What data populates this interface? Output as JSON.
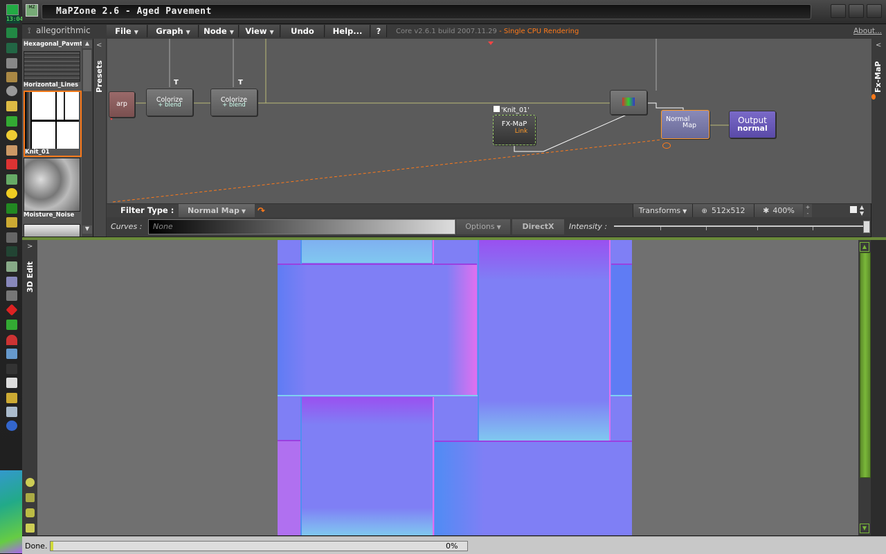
{
  "taskbar": {
    "clock": "13:04",
    "icons": [
      "CPU",
      "RAM",
      "Star",
      "cdrom",
      "folder",
      "chrome",
      "smiley",
      "user",
      "undo",
      "globe",
      "search",
      "world",
      "chart",
      "alpha",
      "zoom",
      "waveform",
      "gear",
      "window",
      "tool",
      "diamond",
      "bug",
      "rainbow",
      "pattern",
      "eyes",
      "printer",
      "hand",
      "ship",
      "earth"
    ]
  },
  "window": {
    "title": "MaPZone 2.6 - Aged Pavement"
  },
  "menubar": {
    "logo": "allegorithmic",
    "items": [
      {
        "label": "File",
        "dropdown": true
      },
      {
        "label": "Graph",
        "dropdown": true
      },
      {
        "label": "Node",
        "dropdown": true
      },
      {
        "label": "View",
        "dropdown": true
      },
      {
        "label": "Undo",
        "dropdown": false
      },
      {
        "label": "Help...",
        "dropdown": false
      },
      {
        "label": "?",
        "dropdown": false
      }
    ],
    "build": "Core v2.6.1 build 2007.11.29",
    "build_warning": " - Single CPU Rendering",
    "about": "About..."
  },
  "presets": {
    "tab_label": "Presets",
    "items": [
      {
        "label": "Hexagonal_Pavmt"
      },
      {
        "label": "Horizontal_Lines"
      },
      {
        "label": "Knit_01"
      },
      {
        "label": "Moisture_Noise"
      }
    ]
  },
  "graph": {
    "nodes": {
      "warp": "arp",
      "colorize1": {
        "line1": "Colorize",
        "line2": "+ blend"
      },
      "colorize2": {
        "line1": "Colorize",
        "line2": "+ blend"
      },
      "t_marker": "T",
      "fxmap_title": "'Knit_01'",
      "fxmap": {
        "line1": "FX-MaP",
        "line2": "Link"
      },
      "normal": {
        "line1": "Normal",
        "line2": "Map"
      },
      "output": {
        "line1": "Output",
        "line2": "normal"
      }
    }
  },
  "filterbar": {
    "label": "Filter Type :",
    "selected": "Normal Map",
    "transforms": "Transforms",
    "resolution": "512x512",
    "zoom": "400%"
  },
  "curvesbar": {
    "curves_label": "Curves :",
    "curves_value": "None",
    "options": "Options",
    "directx": "DirectX",
    "intensity_label": "Intensity :",
    "intensity_value": 1.0
  },
  "right_tab": {
    "label": "Fx-MaP"
  },
  "edit3d": {
    "label": "3D Edit",
    "expand": ">"
  },
  "statusbar": {
    "status": "Done.",
    "progress": 0.0,
    "progress_text": "0%"
  },
  "colors": {
    "accent_orange": "#ff7a1a",
    "scroll_green": "#7ab83a",
    "normal_blue": "#7f7ff5",
    "normal_violet": "#a65cf0"
  }
}
